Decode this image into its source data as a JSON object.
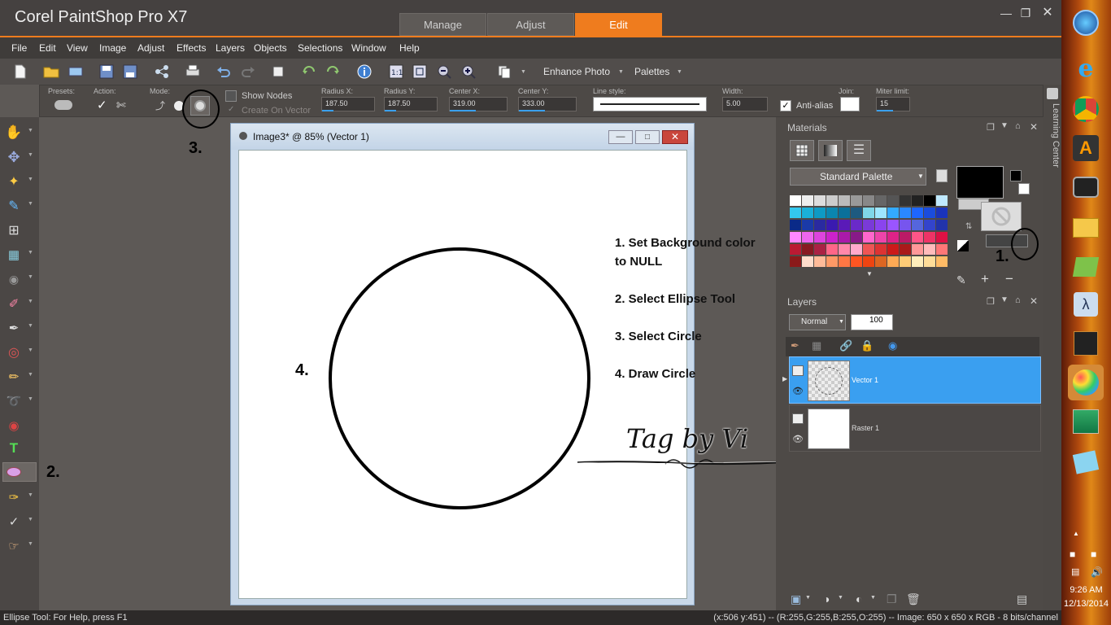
{
  "app": {
    "title": "Corel PaintShop Pro X7"
  },
  "workspace_tabs": [
    {
      "label": "Manage"
    },
    {
      "label": "Adjust"
    },
    {
      "label": "Edit"
    }
  ],
  "menu": [
    "File",
    "Edit",
    "View",
    "Image",
    "Adjust",
    "Effects",
    "Layers",
    "Objects",
    "Selections",
    "Window",
    "Help"
  ],
  "toolbar": {
    "enhance_photo": "Enhance Photo",
    "palettes": "Palettes"
  },
  "tool_options": {
    "presets_label": "Presets:",
    "action_label": "Action:",
    "mode_label": "Mode:",
    "show_nodes": "Show Nodes",
    "create_on_vector": "Create On Vector",
    "radius_x_label": "Radius X:",
    "radius_x": "187.50",
    "radius_y_label": "Radius Y:",
    "radius_y": "187.50",
    "center_x_label": "Center X:",
    "center_x": "319.00",
    "center_y_label": "Center Y:",
    "center_y": "333.00",
    "line_style_label": "Line style:",
    "width_label": "Width:",
    "width": "5.00",
    "anti_alias": "Anti-alias",
    "join_label": "Join:",
    "miter_label": "Miter limit:",
    "miter": "15"
  },
  "image_window": {
    "title": "Image3* @  85% (Vector 1)"
  },
  "instructions": {
    "step1a": "1. Set Background color",
    "step1b": "to NULL",
    "step2": "2. Select Ellipse Tool",
    "step3": "3. Select Circle",
    "step4": "4. Draw Circle"
  },
  "annotations": {
    "a1": "1.",
    "a2": "2.",
    "a3": "3.",
    "a4": "4."
  },
  "watermark": "Tag by Vi",
  "materials": {
    "title": "Materials",
    "palette": "Standard Palette",
    "swatches": [
      [
        "#ffffff",
        "#eeeeee",
        "#dddddd",
        "#cccccc",
        "#bbbbbb",
        "#999999",
        "#888888",
        "#666666",
        "#555555",
        "#333333",
        "#222222",
        "#000000",
        "#bfe9ff"
      ],
      [
        "#33c8ee",
        "#1ab0d8",
        "#0e9ac4",
        "#0a86b0",
        "#0a709a",
        "#1e5a80",
        "#7fd6e8",
        "#9ee6ff",
        "#33aaff",
        "#2a88ff",
        "#1e66ff",
        "#1a4cdd",
        "#1a33bb"
      ],
      [
        "#0a2a88",
        "#1a3aa8",
        "#2a2aa0",
        "#3a1ab0",
        "#5a1ab8",
        "#6a2ac8",
        "#7a3ad8",
        "#8a44ee",
        "#9a55ff",
        "#7755ee",
        "#5566dd",
        "#3344cc",
        "#2233aa"
      ],
      [
        "#ff88ff",
        "#ee66ee",
        "#dd44dd",
        "#cc22cc",
        "#aa1aaa",
        "#881a88",
        "#ff66cc",
        "#ee44aa",
        "#dd2288",
        "#bb1a66",
        "#ff5588",
        "#ee3366",
        "#dd1144"
      ],
      [
        "#bb1a33",
        "#881a22",
        "#aa2244",
        "#ff6688",
        "#ff88aa",
        "#ffaacc",
        "#ee5555",
        "#dd3333",
        "#cc1a1a",
        "#aa1a1a",
        "#ff9999",
        "#ffbbbb",
        "#ff7777"
      ],
      [
        "#8a1a1a",
        "#ffddcc",
        "#ffbb99",
        "#ff9966",
        "#ff7744",
        "#ff5522",
        "#ee4411",
        "#dd6622",
        "#ffaa55",
        "#ffcc77",
        "#ffeebb",
        "#ffdd99",
        "#ffbb66"
      ]
    ]
  },
  "layers": {
    "title": "Layers",
    "blend": "Normal",
    "opacity": "100",
    "items": [
      {
        "name": "Vector 1"
      },
      {
        "name": "Raster 1"
      }
    ]
  },
  "learning_center": "Learning Center",
  "status": {
    "left": "Ellipse Tool: For Help, press F1",
    "right": "(x:506 y:451) -- (R:255,G:255,B:255,O:255) -- Image:  650 x 650 x RGB - 8 bits/channel"
  },
  "clock": {
    "time": "9:26 AM",
    "date": "12/13/2014"
  },
  "colors": {
    "accent": "#ef7c1e",
    "layer_selected": "#3a9ff0"
  }
}
